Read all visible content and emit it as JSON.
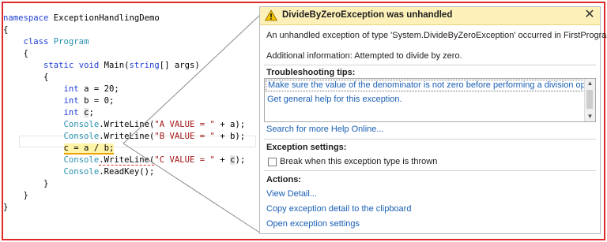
{
  "code": {
    "lines": [
      [
        "namespace ExceptionHandlingDemo"
      ],
      [
        "{"
      ],
      [
        "    class Program"
      ],
      [
        "    {"
      ],
      [
        "        static void Main(string[] args)"
      ],
      [
        "        {"
      ],
      [
        "            int a = 20;"
      ],
      [
        "            int b = 0;"
      ],
      [
        "            int c;"
      ],
      [
        "            Console.WriteLine(\"A VALUE = \" + a);"
      ],
      [
        "            Console.WriteLine(\"B VALUE = \" + b);"
      ],
      [
        "            c = a / b;"
      ],
      [
        "            Console.WriteLine(\"C VALUE = \" + c);"
      ],
      [
        "            Console.ReadKey();"
      ],
      [
        "        }"
      ],
      [
        "    }"
      ],
      [
        "}"
      ]
    ],
    "tokens": {
      "namespace": "namespace",
      "ns_name": "ExceptionHandlingDemo",
      "open_brace": "{",
      "close_brace": "}",
      "class": "class",
      "program": "Program",
      "static": "static",
      "void": "void",
      "main": "Main(",
      "string": "string",
      "args": "[] args)",
      "int": "int",
      "a_decl": " a = 20;",
      "b_decl": " b = 0;",
      "c_var": "c",
      "semicolon": ";",
      "console": "Console",
      "writeline": ".WriteLine(",
      "str_a": "\"A VALUE = \"",
      "str_b": "\"B VALUE = \"",
      "str_c": "\"C VALUE = \"",
      "plus_a": " + a);",
      "plus_b": " + b);",
      "plus": " + ",
      "close_paren": ");",
      "div_stmt": "c = a / b;",
      "readkey": ".ReadKey();"
    }
  },
  "popup": {
    "title": "DivideByZeroException was unhandled",
    "close_glyph": "✕",
    "message": "An unhandled exception of type 'System.DivideByZeroException' occurred in FirstProgram.exe",
    "additional_info": "Additional information: Attempted to divide by zero.",
    "tips_heading": "Troubleshooting tips:",
    "tips": [
      "Make sure the value of the denominator is not zero before performing a division operation.",
      "Get general help for this exception."
    ],
    "search_help": "Search for more Help Online...",
    "settings_heading": "Exception settings:",
    "break_checkbox_label": "Break when this exception type is thrown",
    "break_checkbox_checked": false,
    "actions_heading": "Actions:",
    "actions": [
      "View Detail...",
      "Copy exception detail to the clipboard",
      "Open exception settings"
    ],
    "icons": {
      "warning": "warning-icon",
      "close": "close-icon",
      "scroll_up": "scroll-up-icon",
      "scroll_down": "scroll-down-icon"
    },
    "colors": {
      "header_bg": "#fdf0b8",
      "link": "#1a5fb4",
      "frame_border": "#e02a2a"
    }
  }
}
